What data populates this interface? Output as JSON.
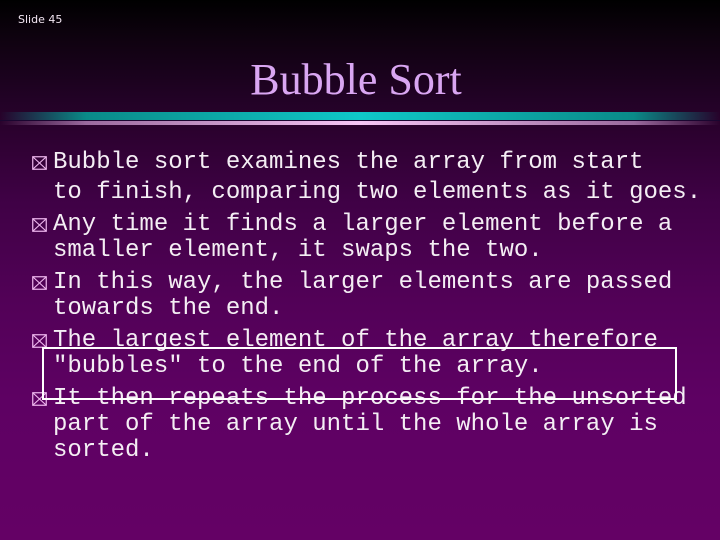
{
  "slide": {
    "number_label": "Slide 45",
    "title": "Bubble Sort"
  },
  "colors": {
    "title": "#d9a6f2",
    "body_text": "#f4eef4",
    "bullet": "#f0b8f0",
    "separator_cyan": "#0fc8c8",
    "separator_pink": "#f6c6f6",
    "highlight_box": "#ffffff"
  },
  "bullet_icon": "box-x-icon",
  "bullets": [
    {
      "lines": [
        "Bubble sort examines the array from start",
        "to finish, comparing two elements as it goes."
      ]
    },
    {
      "lines": [
        "Any time it finds a larger element before a",
        "smaller element, it swaps the two."
      ]
    },
    {
      "lines": [
        "In this way, the larger elements are passed",
        "towards the end."
      ]
    },
    {
      "lines": [
        "The largest element of the array therefore",
        "\"bubbles\" to the end of the array."
      ]
    },
    {
      "lines": [
        "It then repeats the process for the unsorted",
        "part of the array until the whole array is",
        "sorted."
      ]
    }
  ]
}
